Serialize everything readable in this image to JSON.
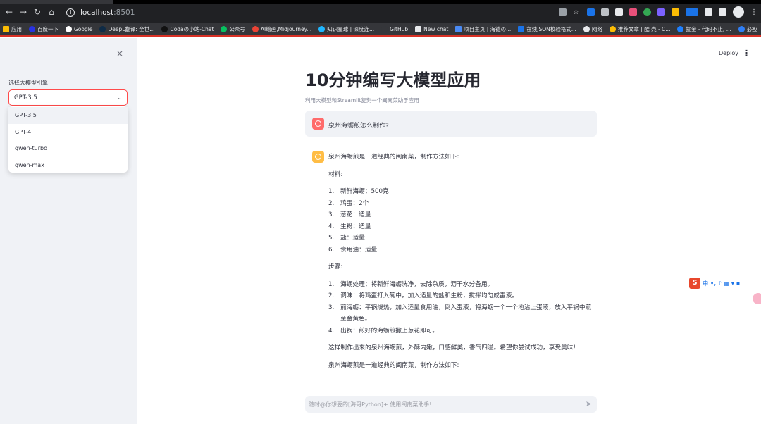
{
  "browser": {
    "address": {
      "host": "localhost",
      "port": ":8501"
    },
    "bookmarks": [
      "应用",
      "百度一下",
      "Google",
      "DeepL翻译: 全世...",
      "Codaの小站-Chat",
      "公众号",
      "AI绘画,Midjourney...",
      "知识星球 | 深度连...",
      "GitHub",
      "New chat",
      "项目主页 | 海德の...",
      "在线JSON校验格式...",
      "网络",
      "推荐文章 | 酷 壳 - C...",
      "掘金 - 代码不止, ...",
      "必应"
    ],
    "bookmark_more": "»"
  },
  "sidebar": {
    "close": "×",
    "label": "选择大模型引擎",
    "selected": "GPT-3.5",
    "options": [
      "GPT-3.5",
      "GPT-4",
      "qwen-turbo",
      "qwen-max"
    ]
  },
  "header": {
    "deploy": "Deploy",
    "menu": "⋮"
  },
  "main": {
    "title": "10分钟编写大模型应用",
    "caption": "利用大模型和Streamlit复刻一个闽南菜助手应用",
    "user_message": "泉州海蛎煎怎么制作?",
    "assistant": {
      "intro": "泉州海蛎煎是一道经典的闽南菜，制作方法如下:",
      "materials_label": "材料:",
      "materials": [
        "新鲜海蛎：500克",
        "鸡蛋：2个",
        "葱花：适量",
        "生粉：适量",
        "盐：适量",
        "食用油：适量"
      ],
      "steps_label": "步骤:",
      "steps": [
        "海蛎处理：将新鲜海蛎洗净，去除杂质，沥干水分备用。",
        "调味：将鸡蛋打入碗中，加入适量的盐和生粉，搅拌均匀成蛋液。",
        "煎海蛎：平锅烧热，加入适量食用油，倒入蛋液，将海蛎一个一个地沾上蛋液，放入平锅中煎至金黄色。",
        "出锅：煎好的海蛎煎撒上葱花即可。"
      ],
      "closing": "这样制作出来的泉州海蛎煎，外酥内嫩，口感鲜美，香气四溢。希望你尝试成功，享受美味!",
      "repeat": "泉州海蛎煎是一道经典的闽南菜，制作方法如下:"
    },
    "input_placeholder": "随时@你想要的[海哥Python]+ 使用闽南菜助手!"
  },
  "ime": {
    "label": "中"
  },
  "colors": {
    "accent": "#ff4b4b",
    "user_avatar": "#ff6b6b",
    "assistant_avatar": "#ffbd45",
    "sidebar_bg": "#f0f2f6"
  }
}
